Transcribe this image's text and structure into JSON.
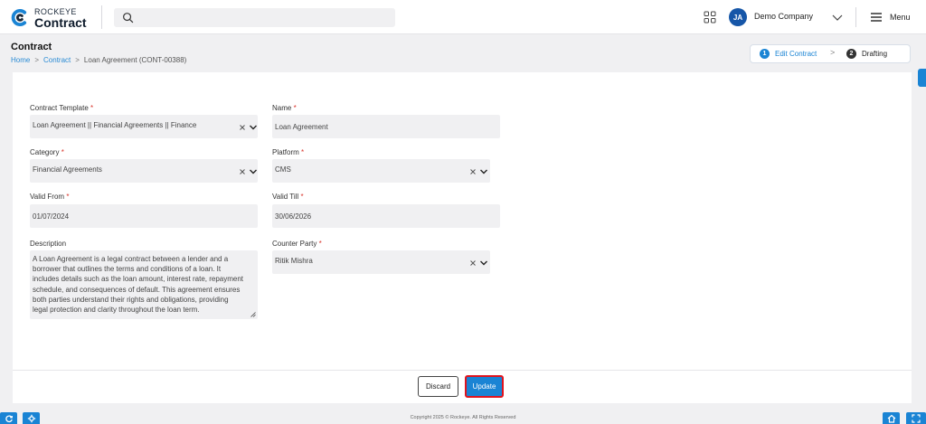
{
  "app": {
    "logo_top": "ROCKEYE",
    "logo_bottom": "Contract",
    "brand_color": "#1a84d4"
  },
  "header": {
    "search_placeholder": "",
    "avatar_initials": "JA",
    "company_name": "Demo Company",
    "menu_label": "Menu",
    "icons": [
      "search-icon",
      "apps-grid-icon",
      "chevron-down-icon",
      "hamburger-menu-icon"
    ]
  },
  "page": {
    "title": "Contract",
    "breadcrumb": [
      "Home",
      "Contract",
      "Loan Agreement (CONT-00388)"
    ],
    "breadcrumb_separator": ">"
  },
  "stepper": {
    "steps": [
      {
        "number": "1",
        "label": "Edit Contract",
        "active": true
      },
      {
        "number": "2",
        "label": "Drafting",
        "active": false
      }
    ],
    "separator": ">"
  },
  "form": {
    "required_mark": "*",
    "contract_template": {
      "label": "Contract Template",
      "value": "Loan Agreement || Financial Agreements || Finance"
    },
    "name": {
      "label": "Name",
      "value": "Loan Agreement"
    },
    "category": {
      "label": "Category",
      "value": "Financial Agreements"
    },
    "platform": {
      "label": "Platform",
      "value": "CMS"
    },
    "valid_from": {
      "label": "Valid From",
      "value": "01/07/2024"
    },
    "valid_till": {
      "label": "Valid Till",
      "value": "30/06/2026"
    },
    "description": {
      "label": "Description",
      "lines": [
        "A Loan Agreement is a legal contract between a lender and a",
        "borrower that outlines the terms and conditions of a loan. It",
        "includes details such as the loan amount, interest rate, repayment",
        "schedule, and consequences of default. This agreement ensures",
        "both parties understand their rights and obligations, providing",
        "legal protection and clarity throughout the loan term."
      ]
    },
    "counter_party": {
      "label": "Counter Party",
      "value": "Ritik Mishra"
    }
  },
  "actions": {
    "discard_label": "Discard",
    "update_label": "Update",
    "highlight_color": "#e0141e"
  },
  "footer": {
    "copyright": "Copyright 2025 © Rockeye. All Rights Reserved"
  }
}
